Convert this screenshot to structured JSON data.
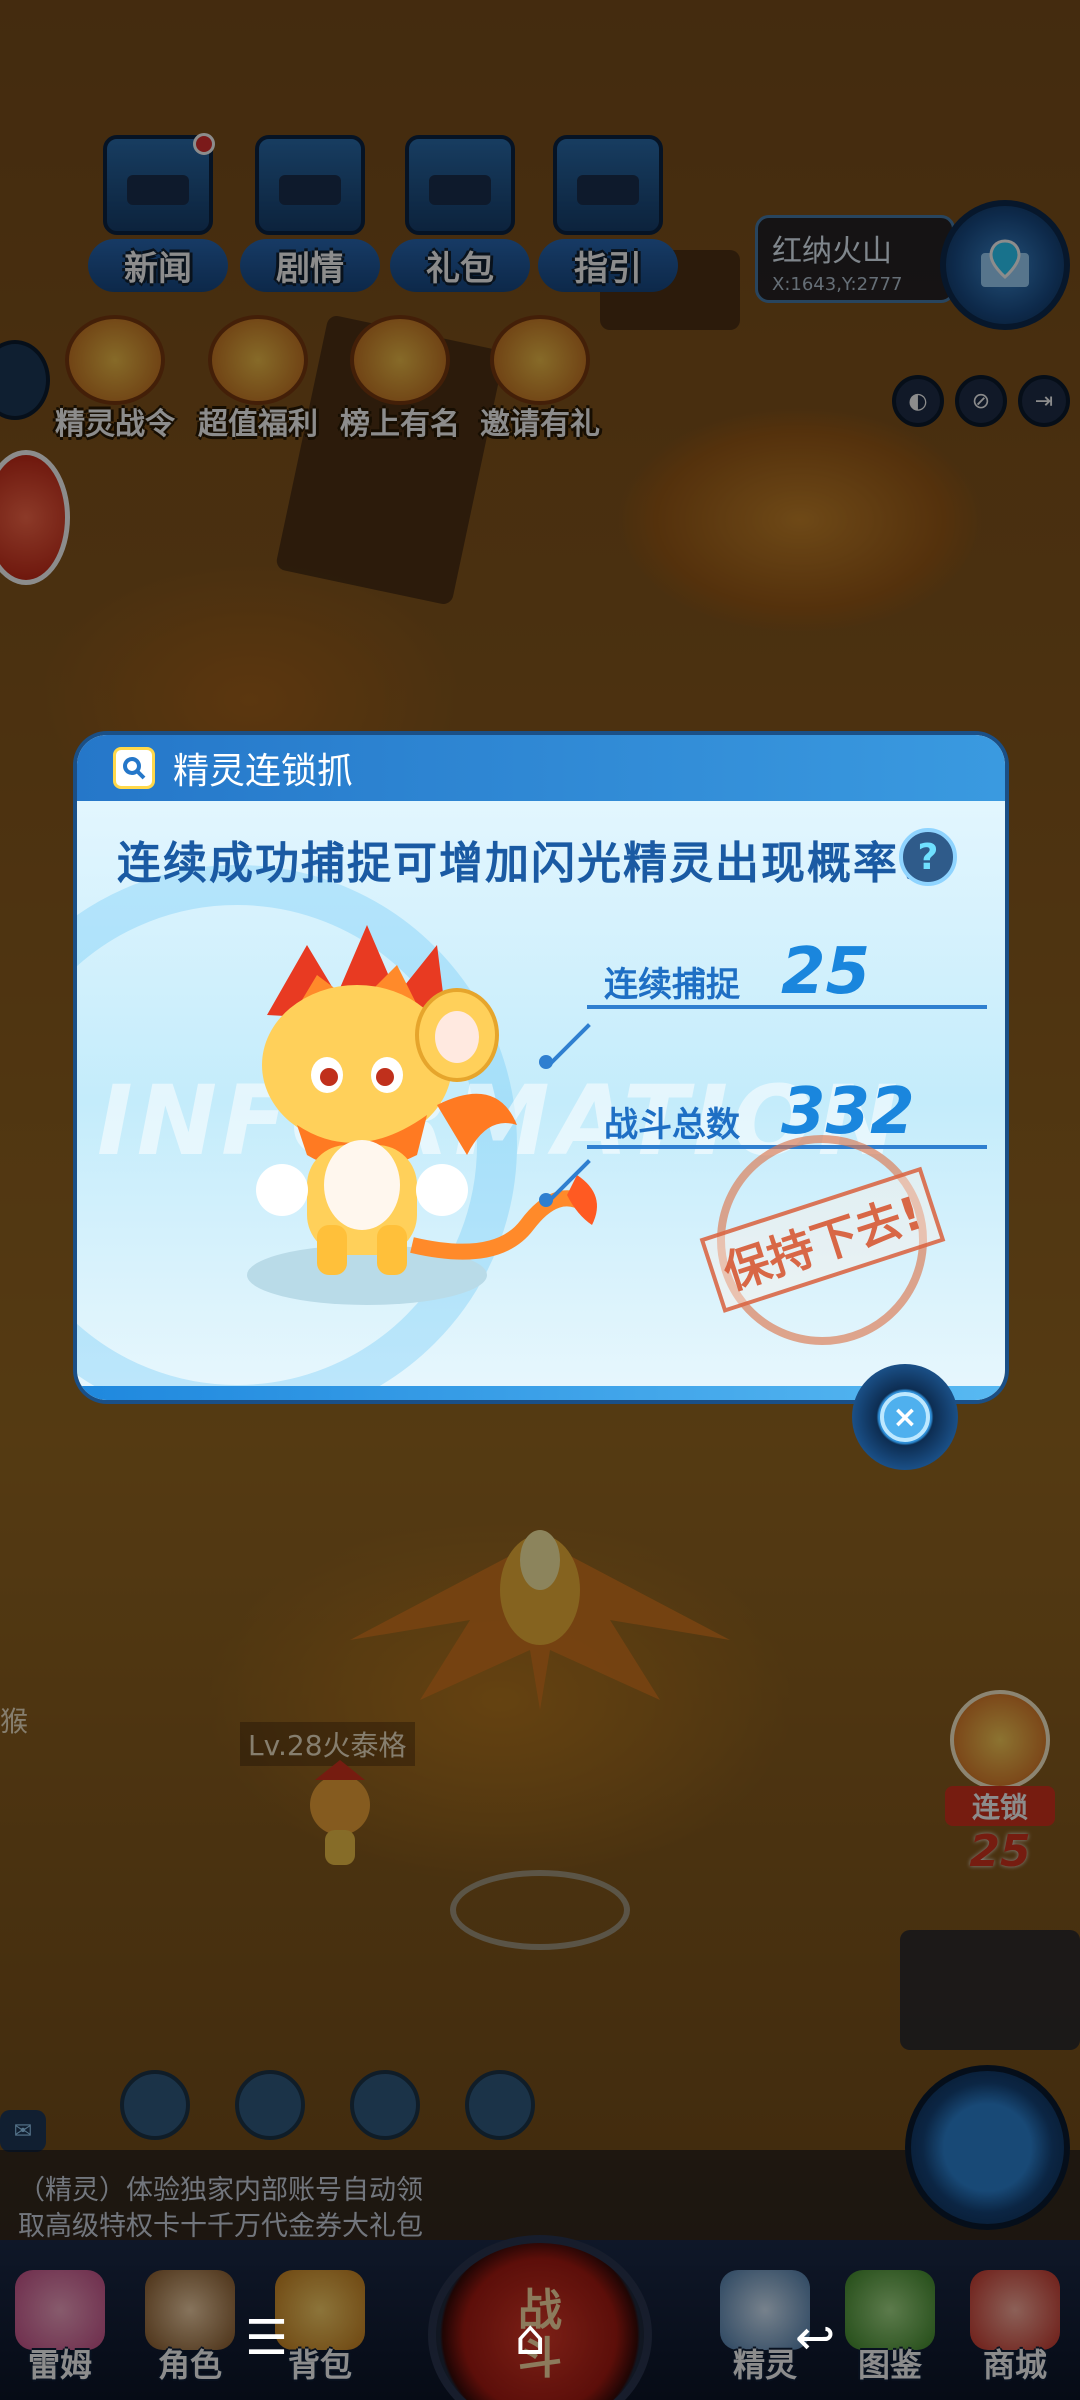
{
  "top_menu": {
    "items": [
      {
        "label": "新闻",
        "icon": "tv-icon"
      },
      {
        "label": "剧情",
        "icon": "book-icon"
      },
      {
        "label": "礼包",
        "icon": "gift-box-icon"
      },
      {
        "label": "指引",
        "icon": "guide-icon"
      }
    ]
  },
  "location": {
    "name": "红纳火山",
    "coords": "X:1643,Y:2777"
  },
  "second_menu": {
    "items": [
      {
        "label": "精灵战令"
      },
      {
        "label": "超值福利"
      },
      {
        "label": "榜上有名"
      },
      {
        "label": "邀请有礼"
      }
    ]
  },
  "dialog": {
    "title": "精灵连锁抓",
    "subtitle": "连续成功捕捉可增加闪光精灵出现概率！",
    "help": "?",
    "watermark": "INFORMATION",
    "stats": [
      {
        "label": "连续捕捉",
        "value": "25"
      },
      {
        "label": "战斗总数",
        "value": "332"
      }
    ],
    "stamp": "保持下去!",
    "close": "×"
  },
  "scene": {
    "monster_label": "Lv.28火泰格",
    "side_label": "猴",
    "combo": {
      "label": "连锁",
      "value": "25"
    }
  },
  "chat": {
    "lines": [
      "（精灵）体验独家内部账号自动领",
      "取高级特权卡十千万代金券大礼包"
    ]
  },
  "bottom_nav": {
    "items": [
      {
        "label": "雷姆"
      },
      {
        "label": "角色"
      },
      {
        "label": "背包"
      },
      {
        "label": "精灵"
      },
      {
        "label": "图鉴"
      },
      {
        "label": "商城"
      }
    ],
    "battle": "战斗"
  },
  "system_nav": {
    "menu": "☰",
    "home": "⌂",
    "back": "↩"
  },
  "colors": {
    "accent": "#1a86dd",
    "header": "#2577c9",
    "stamp": "#d75f3c"
  }
}
